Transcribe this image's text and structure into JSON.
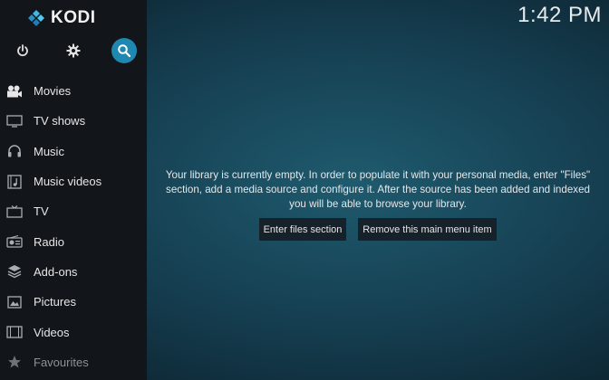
{
  "app": {
    "name": "KODI"
  },
  "clock": "1:42 PM",
  "top_buttons": [
    {
      "name": "power-icon"
    },
    {
      "name": "gear-icon"
    },
    {
      "name": "search-icon"
    }
  ],
  "menu": [
    {
      "label": "Movies",
      "icon": "movies-icon"
    },
    {
      "label": "TV shows",
      "icon": "tv-shows-icon"
    },
    {
      "label": "Music",
      "icon": "headphones-icon"
    },
    {
      "label": "Music videos",
      "icon": "music-videos-icon"
    },
    {
      "label": "TV",
      "icon": "tv-icon"
    },
    {
      "label": "Radio",
      "icon": "radio-icon"
    },
    {
      "label": "Add-ons",
      "icon": "addons-icon"
    },
    {
      "label": "Pictures",
      "icon": "pictures-icon"
    },
    {
      "label": "Videos",
      "icon": "videos-icon"
    },
    {
      "label": "Favourites",
      "icon": "star-icon"
    }
  ],
  "message": "Your library is currently empty. In order to populate it with your personal media, enter \"Files\" section, add a media source and configure it. After the source has been added and indexed you will be able to browse your library.",
  "buttons": {
    "enter_files": "Enter files section",
    "remove_item": "Remove this main menu item"
  },
  "colors": {
    "accent": "#1e88b0",
    "sidebar_bg": "#12161a",
    "background": "#153e50"
  }
}
